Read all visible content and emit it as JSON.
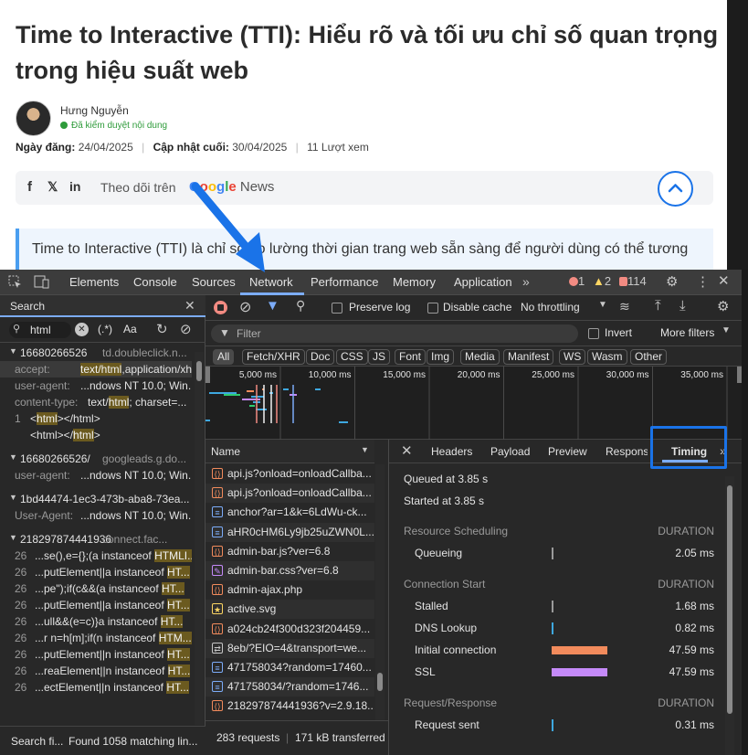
{
  "article": {
    "title": "Time to Interactive (TTI): Hiểu rõ và tối ưu chỉ số quan trọng trong hiệu suất web",
    "author_name": "Hưng Nguyễn",
    "verified_label": "Đã kiểm duyệt nội dung",
    "published_label": "Ngày đăng:",
    "published_date": "24/04/2025",
    "updated_label": "Cập nhật cuối:",
    "updated_date": "30/04/2025",
    "views": "11 Lượt xem",
    "share": {
      "facebook": "f",
      "x": "𝕏",
      "linkedin": "in",
      "follow_text": "Theo dõi trên",
      "google_letters": [
        "G",
        "o",
        "o",
        "g",
        "l",
        "e"
      ],
      "google_colors": [
        "#4285F4",
        "#EA4335",
        "#FBBC05",
        "#4285F4",
        "#34A853",
        "#EA4335"
      ],
      "news_label": "News"
    },
    "intro_text": "Time to Interactive (TTI) là chỉ số đo lường thời gian trang web sẵn sàng để người dùng có thể tương"
  },
  "devtools": {
    "tabs": [
      "Elements",
      "Console",
      "Sources",
      "Network",
      "Performance",
      "Memory",
      "Application"
    ],
    "active_tab": "Network",
    "errors": "1",
    "warnings": "2",
    "issues": "114",
    "error_color": "#f28b82",
    "warning_color": "#fdd663"
  },
  "search": {
    "title": "Search",
    "query": "html",
    "regex_label": "(.*)",
    "case_label": "Aa",
    "results": [
      {
        "kind": "file",
        "name": "16680266526",
        "host": "td.doubleclick.n..."
      },
      {
        "kind": "line",
        "key": "accept:",
        "pre": "",
        "hl": "text/html",
        "post": ",application/xht...",
        "selected": true
      },
      {
        "kind": "line",
        "key": "user-agent:",
        "pre": "...ndows NT 10.0; Win...",
        "hl": "",
        "post": ""
      },
      {
        "kind": "line",
        "key": "content-type:",
        "pre": "text/",
        "hl": "html",
        "post": "; charset=..."
      },
      {
        "kind": "code",
        "num": "1",
        "pre": "<",
        "hl": "html",
        "post": "></html>"
      },
      {
        "kind": "code",
        "num": "",
        "pre": "<html></",
        "hl": "html",
        "post": ">"
      },
      {
        "kind": "file",
        "name": "16680266526/",
        "host": "googleads.g.do..."
      },
      {
        "kind": "line",
        "key": "user-agent:",
        "pre": "...ndows NT 10.0; Win...",
        "hl": "",
        "post": ""
      },
      {
        "kind": "file",
        "name": "1bd44474-1ec3-473b-aba8-73ea...",
        "host": ""
      },
      {
        "kind": "line",
        "key": "User-Agent:",
        "pre": "...ndows NT 10.0; Win...",
        "hl": "",
        "post": ""
      },
      {
        "kind": "file",
        "name": "218297874441936",
        "host": "connect.fac..."
      },
      {
        "kind": "code",
        "num": "26",
        "pre": "...se(),e={};(a instanceof ",
        "hl": "HTMLI...",
        "post": ""
      },
      {
        "kind": "code",
        "num": "26",
        "pre": "...putElement||a instanceof ",
        "hl": "HT...",
        "post": ""
      },
      {
        "kind": "code",
        "num": "26",
        "pre": "...pe\");if(c&&(a instanceof ",
        "hl": "HT...",
        "post": ""
      },
      {
        "kind": "code",
        "num": "26",
        "pre": "...putElement||a instanceof ",
        "hl": "HT...",
        "post": ""
      },
      {
        "kind": "code",
        "num": "26",
        "pre": "...ull&&(e=c)}a instanceof ",
        "hl": "HT...",
        "post": ""
      },
      {
        "kind": "code",
        "num": "26",
        "pre": "...r n=h[m];if(n instanceof ",
        "hl": "HTM...",
        "post": ""
      },
      {
        "kind": "code",
        "num": "26",
        "pre": "...putElement||n instanceof ",
        "hl": "HT...",
        "post": ""
      },
      {
        "kind": "code",
        "num": "26",
        "pre": "...reaElement||n instanceof ",
        "hl": "HT...",
        "post": ""
      },
      {
        "kind": "code",
        "num": "26",
        "pre": "...ectElement||n instanceof ",
        "hl": "HT...",
        "post": ""
      }
    ],
    "footer_left": "Search fi...",
    "footer_right": "Found 1058 matching lin..."
  },
  "network": {
    "preserve_log": "Preserve log",
    "disable_cache": "Disable cache",
    "throttling": "No throttling",
    "filter_placeholder": "Filter",
    "invert": "Invert",
    "more_filters": "More filters",
    "types": [
      "All",
      "Fetch/XHR",
      "Doc",
      "CSS",
      "JS",
      "Font",
      "Img",
      "Media",
      "Manifest",
      "WS",
      "Wasm",
      "Other"
    ],
    "active_type": "All",
    "timeline_ticks": [
      "5,000 ms",
      "10,000 ms",
      "15,000 ms",
      "20,000 ms",
      "25,000 ms",
      "30,000 ms",
      "35,000 ms"
    ],
    "name_header": "Name",
    "requests": [
      {
        "name": "api.js?onload=onloadCallba...",
        "icon": "js"
      },
      {
        "name": "api.js?onload=onloadCallba...",
        "icon": "js"
      },
      {
        "name": "anchor?ar=1&k=6LdWu-ck...",
        "icon": "doc"
      },
      {
        "name": "aHR0cHM6Ly9jb25uZWN0L...",
        "icon": "doc"
      },
      {
        "name": "admin-bar.js?ver=6.8",
        "icon": "js"
      },
      {
        "name": "admin-bar.css?ver=6.8",
        "icon": "css"
      },
      {
        "name": "admin-ajax.php",
        "icon": "js"
      },
      {
        "name": "active.svg",
        "icon": "img"
      },
      {
        "name": "a024cb24f300d323f204459...",
        "icon": "js"
      },
      {
        "name": "8eb/?EIO=4&transport=we...",
        "icon": "ws"
      },
      {
        "name": "471758034?random=17460...",
        "icon": "doc"
      },
      {
        "name": "471758034/?random=1746...",
        "icon": "doc"
      },
      {
        "name": "218297874441936?v=2.9.18...",
        "icon": "js"
      }
    ],
    "footer_requests": "283 requests",
    "footer_transferred": "171 kB transferred"
  },
  "details": {
    "tabs": [
      "Headers",
      "Payload",
      "Preview",
      "Response",
      "Timing"
    ],
    "active_tab": "Timing",
    "queued": "Queued at 3.85 s",
    "started": "Started at 3.85 s",
    "sections": [
      {
        "title": "Resource Scheduling",
        "duration_label": "DURATION",
        "rows": [
          {
            "label": "Queueing",
            "value": "2.05 ms",
            "color": "#9a9a9a",
            "fraction": 0.01
          }
        ]
      },
      {
        "title": "Connection Start",
        "duration_label": "DURATION",
        "rows": [
          {
            "label": "Stalled",
            "value": "1.68 ms",
            "color": "#9a9a9a",
            "fraction": 0.01
          },
          {
            "label": "DNS Lookup",
            "value": "0.82 ms",
            "color": "#3ea8e0",
            "fraction": 0.01
          },
          {
            "label": "Initial connection",
            "value": "47.59 ms",
            "color": "#f28b5c",
            "fraction": 0.5
          },
          {
            "label": "SSL",
            "value": "47.59 ms",
            "color": "#c58af9",
            "fraction": 0.5
          }
        ]
      },
      {
        "title": "Request/Response",
        "duration_label": "DURATION",
        "rows": [
          {
            "label": "Request sent",
            "value": "0.31 ms",
            "color": "#3ea8e0",
            "fraction": 0.01
          }
        ]
      }
    ]
  }
}
